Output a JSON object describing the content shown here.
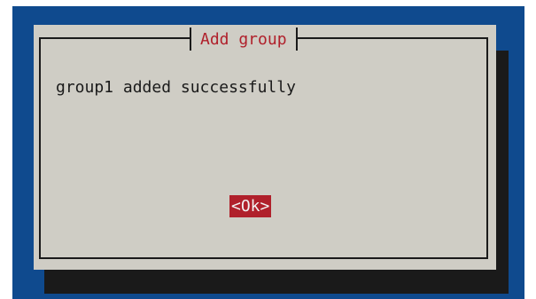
{
  "dialog": {
    "title": "Add group",
    "message": "group1 added successfully",
    "ok_label": "<Ok>"
  },
  "colors": {
    "background": "#0f4a8e",
    "dialog": "#cfcdc5",
    "shadow": "#1a1a1a",
    "accent": "#b0202b"
  }
}
